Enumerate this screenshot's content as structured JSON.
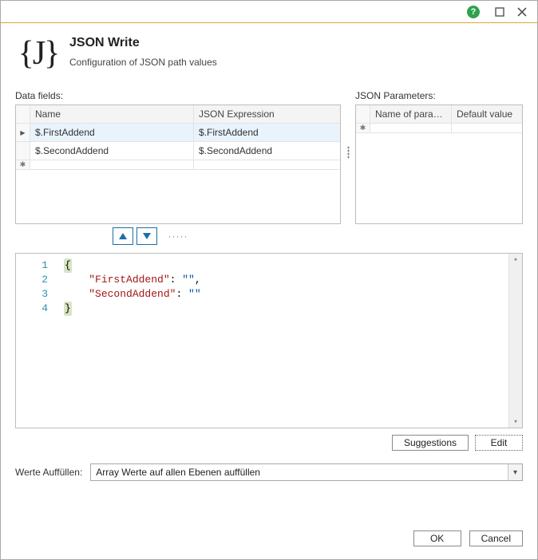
{
  "titlebar": {
    "help_tooltip": "?",
    "maximize_tooltip": "Maximize",
    "close_tooltip": "Close"
  },
  "header": {
    "icon_text": "{J}",
    "title": "JSON Write",
    "subtitle": "Configuration of JSON path values"
  },
  "data_fields": {
    "label": "Data fields:",
    "columns": {
      "name": "Name",
      "expr": "JSON Expression"
    },
    "rows": [
      {
        "name": "$.FirstAddend",
        "expr": "$.FirstAddend",
        "selected": true
      },
      {
        "name": "$.SecondAddend",
        "expr": "$.SecondAddend",
        "selected": false
      }
    ]
  },
  "json_params": {
    "label": "JSON Parameters:",
    "columns": {
      "name": "Name of parameter",
      "def": "Default value"
    },
    "rows": []
  },
  "editor": {
    "lines": [
      "{",
      "    \"FirstAddend\": \"\",",
      "    \"SecondAddend\": \"\"",
      "}"
    ]
  },
  "actions": {
    "suggestions": "Suggestions",
    "edit": "Edit"
  },
  "werte": {
    "label": "Werte Auffüllen:",
    "value": "Array Werte auf allen Ebenen auffüllen"
  },
  "footer": {
    "ok": "OK",
    "cancel": "Cancel"
  }
}
